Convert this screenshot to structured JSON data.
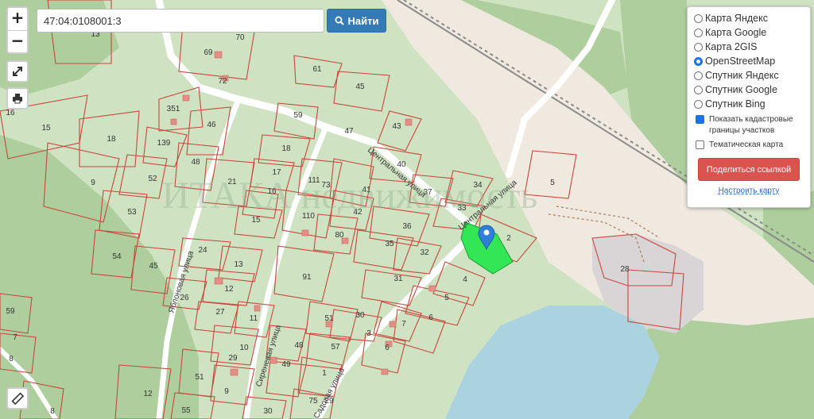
{
  "search": {
    "value": "47:04:0108001:3",
    "button_label": "Найти"
  },
  "zoom": {
    "in_label": "+",
    "out_label": "−"
  },
  "layers": {
    "options": [
      "Карта Яндекс",
      "Карта Google",
      "Карта 2GIS",
      "OpenStreetMap",
      "Спутник Яндекс",
      "Спутник Google",
      "Спутник Bing"
    ],
    "selected": "OpenStreetMap",
    "show_cadastral_label": "Показать кадастровые границы участков",
    "show_cadastral": true,
    "thematic_label": "Тематическая карта",
    "thematic": false,
    "share_label": "Поделиться ссылкой",
    "configure_label": "Настроить карту"
  },
  "map": {
    "streets": [
      "Центральная улица",
      "Центральная улица",
      "Яблоновая улица",
      "Сиреневая улица",
      "Садовая улица"
    ],
    "parcel_numbers": [
      "13",
      "70",
      "69",
      "72",
      "61",
      "45",
      "351",
      "46",
      "59",
      "47",
      "43",
      "16",
      "15",
      "18",
      "139",
      "48",
      "52",
      "9",
      "21",
      "17",
      "16",
      "15",
      "18",
      "111",
      "73",
      "41",
      "40",
      "37",
      "34",
      "53",
      "110",
      "80",
      "42",
      "36",
      "33",
      "2",
      "5",
      "54",
      "24",
      "13",
      "45",
      "91",
      "35",
      "32",
      "26",
      "12",
      "4",
      "27",
      "11",
      "59",
      "51",
      "31",
      "5",
      "30",
      "6",
      "7",
      "10",
      "48",
      "49",
      "3",
      "6",
      "7",
      "8",
      "57",
      "1",
      "51",
      "29",
      "9",
      "29",
      "12",
      "8",
      "55",
      "30",
      "75",
      "28"
    ],
    "watermark": "ИТАКА недвижимость"
  },
  "icons": {
    "zoom_in": "plus-icon",
    "fullscreen": "expand-icon",
    "print": "printer-icon",
    "ruler": "ruler-icon",
    "marker": "map-marker-icon",
    "search": "search-icon"
  }
}
